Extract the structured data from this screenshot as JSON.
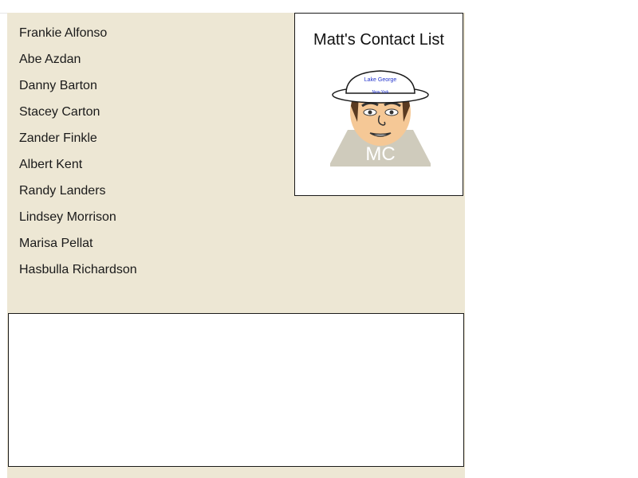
{
  "header": {
    "title": "Matt's Contact List"
  },
  "logo": {
    "hat_line1": "Lake George",
    "hat_line2": "New York",
    "initials": "MC",
    "icon": "avatar-cartoon-man-with-hat"
  },
  "contacts": [
    {
      "name": "Frankie Alfonso"
    },
    {
      "name": "Abe Azdan"
    },
    {
      "name": "Danny Barton"
    },
    {
      "name": "Stacey Carton"
    },
    {
      "name": "Zander Finkle"
    },
    {
      "name": "Albert Kent"
    },
    {
      "name": "Randy Landers"
    },
    {
      "name": "Lindsey Morrison"
    },
    {
      "name": "Marisa Pellat"
    },
    {
      "name": "Hasbulla Richardson"
    }
  ],
  "detail": {
    "content": ""
  },
  "colors": {
    "background": "#ede7d4",
    "panel": "#ffffff",
    "border": "#1a1a1a",
    "hat_text": "#2233cc",
    "skin": "#f5c896",
    "shirt": "#cfcbbc"
  }
}
